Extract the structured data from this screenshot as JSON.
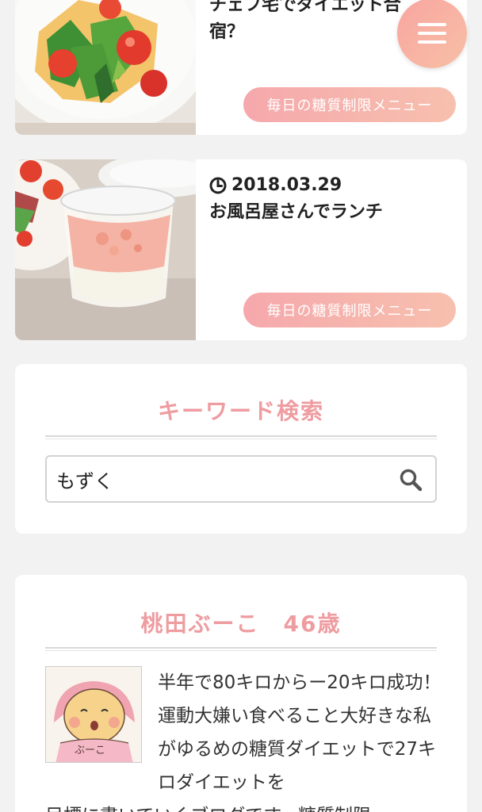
{
  "articles": [
    {
      "title": "チェフ宅でダイエット合宿？",
      "category": "毎日の糖質制限メニュー"
    },
    {
      "date": "2018.03.29",
      "title": "お風呂屋さんでランチ",
      "category": "毎日の糖質制限メニュー"
    }
  ],
  "search_widget": {
    "title": "キーワード検索",
    "value": "もずく"
  },
  "profile_widget": {
    "title": "桃田ぶーこ　46歳",
    "avatar_caption": "ぶーこ",
    "bio": "半年で80キロからー20キロ成功！運動大嫌い食べること大好きな私がゆるめの糖質ダイエットで27キロダイエットを",
    "bio_cont": "目標に書いていくブログです。糖質制限"
  },
  "colors": {
    "accent": "#ee9ca0",
    "button_gradient_start": "#f6a8ac",
    "button_gradient_end": "#f7c0ae",
    "background": "#f2f2f2"
  },
  "icons": {
    "menu": "hamburger-icon",
    "date": "clock-icon",
    "search": "search-icon"
  }
}
